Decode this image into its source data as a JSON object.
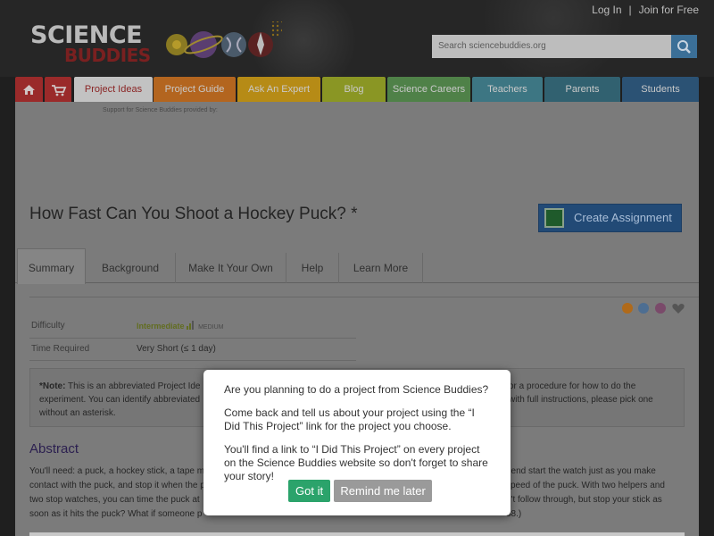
{
  "header": {
    "logo_line1": "SCIENCE",
    "logo_line2": "BUDDIES",
    "login": "Log In",
    "separator": "|",
    "join": "Join for Free",
    "search_placeholder": "Search sciencebuddies.org"
  },
  "nav": {
    "tabs": [
      {
        "label": "Project Ideas",
        "color": "#c2c2c2"
      },
      {
        "label": "Project Guide",
        "color": "#b3651f"
      },
      {
        "label": "Ask An Expert",
        "color": "#b68b16"
      },
      {
        "label": "Blog",
        "color": "#8a9624"
      },
      {
        "label": "Science Careers",
        "color": "#4f8148"
      },
      {
        "label": "Teachers",
        "color": "#3d7683"
      },
      {
        "label": "Parents",
        "color": "#316170"
      },
      {
        "label": "Students",
        "color": "#2b5274"
      }
    ],
    "home_color": "#9a2a2a",
    "cart_color": "#9a2a2a"
  },
  "page": {
    "support_text": "Support for Science Buddies provided by:",
    "title": "How Fast Can You Shoot a Hockey Puck? *",
    "create_assignment": "Create Assignment",
    "tabs": [
      "Summary",
      "Background",
      "Make It Your Own",
      "Help",
      "Learn More"
    ],
    "difficulty_label": "Difficulty",
    "difficulty_value": "Intermediate",
    "difficulty_sub": "MEDIUM",
    "time_label": "Time Required",
    "time_value": "Very Short (≤ 1 day)",
    "note_line1_a": "*Note:",
    "note_line1_b": " This is an abbreviated Project Ide",
    "note_line1_c": "or a procedure for how to do the",
    "note_line2_a": "experiment. You can identify abbreviated",
    "note_line2_b": "with full instructions, please pick one",
    "note_line3": "without an asterisk.",
    "abstract_heading": "Abstract",
    "abstract_l1a": "You'll need: a puck, a hockey stick, a tape m",
    "abstract_l1b": "riend start the watch just as you make",
    "abstract_l2a": "contact with the puck, and stop it when the p",
    "abstract_l2b": "speed of the puck. With two helpers and",
    "abstract_l3a": "two stop watches, you can time the puck at",
    "abstract_l3b": "n't follow through, but stop your stick as",
    "abstract_l4a": "soon as it hits the puck? What if someone p",
    "abstract_l4b": "38.)"
  },
  "modal": {
    "p1": "Are you planning to do a project from Science Buddies?",
    "p2": "Come back and tell us about your project using the “I Did This Project” link for the project you choose.",
    "p3": "You'll find a link to “I Did This Project” on every project on the Science Buddies website so don't forget to share your story!",
    "got_it": "Got it",
    "remind": "Remind me later"
  }
}
